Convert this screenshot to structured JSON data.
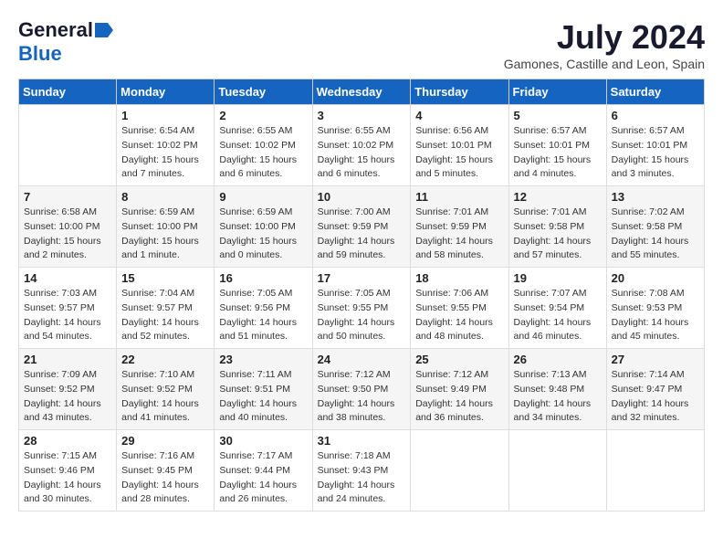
{
  "header": {
    "logo_general": "General",
    "logo_blue": "Blue",
    "month_title": "July 2024",
    "location": "Gamones, Castille and Leon, Spain"
  },
  "weekdays": [
    "Sunday",
    "Monday",
    "Tuesday",
    "Wednesday",
    "Thursday",
    "Friday",
    "Saturday"
  ],
  "weeks": [
    [
      {
        "day": "",
        "sunrise": "",
        "sunset": "",
        "daylight": ""
      },
      {
        "day": "1",
        "sunrise": "Sunrise: 6:54 AM",
        "sunset": "Sunset: 10:02 PM",
        "daylight": "Daylight: 15 hours and 7 minutes."
      },
      {
        "day": "2",
        "sunrise": "Sunrise: 6:55 AM",
        "sunset": "Sunset: 10:02 PM",
        "daylight": "Daylight: 15 hours and 6 minutes."
      },
      {
        "day": "3",
        "sunrise": "Sunrise: 6:55 AM",
        "sunset": "Sunset: 10:02 PM",
        "daylight": "Daylight: 15 hours and 6 minutes."
      },
      {
        "day": "4",
        "sunrise": "Sunrise: 6:56 AM",
        "sunset": "Sunset: 10:01 PM",
        "daylight": "Daylight: 15 hours and 5 minutes."
      },
      {
        "day": "5",
        "sunrise": "Sunrise: 6:57 AM",
        "sunset": "Sunset: 10:01 PM",
        "daylight": "Daylight: 15 hours and 4 minutes."
      },
      {
        "day": "6",
        "sunrise": "Sunrise: 6:57 AM",
        "sunset": "Sunset: 10:01 PM",
        "daylight": "Daylight: 15 hours and 3 minutes."
      }
    ],
    [
      {
        "day": "7",
        "sunrise": "Sunrise: 6:58 AM",
        "sunset": "Sunset: 10:00 PM",
        "daylight": "Daylight: 15 hours and 2 minutes."
      },
      {
        "day": "8",
        "sunrise": "Sunrise: 6:59 AM",
        "sunset": "Sunset: 10:00 PM",
        "daylight": "Daylight: 15 hours and 1 minute."
      },
      {
        "day": "9",
        "sunrise": "Sunrise: 6:59 AM",
        "sunset": "Sunset: 10:00 PM",
        "daylight": "Daylight: 15 hours and 0 minutes."
      },
      {
        "day": "10",
        "sunrise": "Sunrise: 7:00 AM",
        "sunset": "Sunset: 9:59 PM",
        "daylight": "Daylight: 14 hours and 59 minutes."
      },
      {
        "day": "11",
        "sunrise": "Sunrise: 7:01 AM",
        "sunset": "Sunset: 9:59 PM",
        "daylight": "Daylight: 14 hours and 58 minutes."
      },
      {
        "day": "12",
        "sunrise": "Sunrise: 7:01 AM",
        "sunset": "Sunset: 9:58 PM",
        "daylight": "Daylight: 14 hours and 57 minutes."
      },
      {
        "day": "13",
        "sunrise": "Sunrise: 7:02 AM",
        "sunset": "Sunset: 9:58 PM",
        "daylight": "Daylight: 14 hours and 55 minutes."
      }
    ],
    [
      {
        "day": "14",
        "sunrise": "Sunrise: 7:03 AM",
        "sunset": "Sunset: 9:57 PM",
        "daylight": "Daylight: 14 hours and 54 minutes."
      },
      {
        "day": "15",
        "sunrise": "Sunrise: 7:04 AM",
        "sunset": "Sunset: 9:57 PM",
        "daylight": "Daylight: 14 hours and 52 minutes."
      },
      {
        "day": "16",
        "sunrise": "Sunrise: 7:05 AM",
        "sunset": "Sunset: 9:56 PM",
        "daylight": "Daylight: 14 hours and 51 minutes."
      },
      {
        "day": "17",
        "sunrise": "Sunrise: 7:05 AM",
        "sunset": "Sunset: 9:55 PM",
        "daylight": "Daylight: 14 hours and 50 minutes."
      },
      {
        "day": "18",
        "sunrise": "Sunrise: 7:06 AM",
        "sunset": "Sunset: 9:55 PM",
        "daylight": "Daylight: 14 hours and 48 minutes."
      },
      {
        "day": "19",
        "sunrise": "Sunrise: 7:07 AM",
        "sunset": "Sunset: 9:54 PM",
        "daylight": "Daylight: 14 hours and 46 minutes."
      },
      {
        "day": "20",
        "sunrise": "Sunrise: 7:08 AM",
        "sunset": "Sunset: 9:53 PM",
        "daylight": "Daylight: 14 hours and 45 minutes."
      }
    ],
    [
      {
        "day": "21",
        "sunrise": "Sunrise: 7:09 AM",
        "sunset": "Sunset: 9:52 PM",
        "daylight": "Daylight: 14 hours and 43 minutes."
      },
      {
        "day": "22",
        "sunrise": "Sunrise: 7:10 AM",
        "sunset": "Sunset: 9:52 PM",
        "daylight": "Daylight: 14 hours and 41 minutes."
      },
      {
        "day": "23",
        "sunrise": "Sunrise: 7:11 AM",
        "sunset": "Sunset: 9:51 PM",
        "daylight": "Daylight: 14 hours and 40 minutes."
      },
      {
        "day": "24",
        "sunrise": "Sunrise: 7:12 AM",
        "sunset": "Sunset: 9:50 PM",
        "daylight": "Daylight: 14 hours and 38 minutes."
      },
      {
        "day": "25",
        "sunrise": "Sunrise: 7:12 AM",
        "sunset": "Sunset: 9:49 PM",
        "daylight": "Daylight: 14 hours and 36 minutes."
      },
      {
        "day": "26",
        "sunrise": "Sunrise: 7:13 AM",
        "sunset": "Sunset: 9:48 PM",
        "daylight": "Daylight: 14 hours and 34 minutes."
      },
      {
        "day": "27",
        "sunrise": "Sunrise: 7:14 AM",
        "sunset": "Sunset: 9:47 PM",
        "daylight": "Daylight: 14 hours and 32 minutes."
      }
    ],
    [
      {
        "day": "28",
        "sunrise": "Sunrise: 7:15 AM",
        "sunset": "Sunset: 9:46 PM",
        "daylight": "Daylight: 14 hours and 30 minutes."
      },
      {
        "day": "29",
        "sunrise": "Sunrise: 7:16 AM",
        "sunset": "Sunset: 9:45 PM",
        "daylight": "Daylight: 14 hours and 28 minutes."
      },
      {
        "day": "30",
        "sunrise": "Sunrise: 7:17 AM",
        "sunset": "Sunset: 9:44 PM",
        "daylight": "Daylight: 14 hours and 26 minutes."
      },
      {
        "day": "31",
        "sunrise": "Sunrise: 7:18 AM",
        "sunset": "Sunset: 9:43 PM",
        "daylight": "Daylight: 14 hours and 24 minutes."
      },
      {
        "day": "",
        "sunrise": "",
        "sunset": "",
        "daylight": ""
      },
      {
        "day": "",
        "sunrise": "",
        "sunset": "",
        "daylight": ""
      },
      {
        "day": "",
        "sunrise": "",
        "sunset": "",
        "daylight": ""
      }
    ]
  ]
}
